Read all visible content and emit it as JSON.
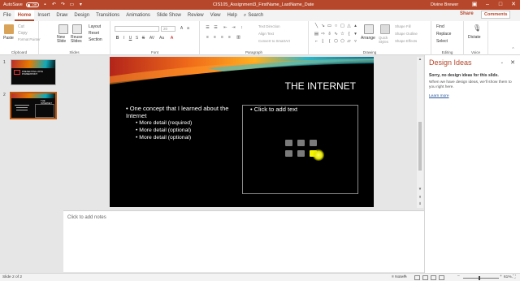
{
  "titlebar": {
    "autosave_label": "AutoSave",
    "autosave_state": "Off",
    "doc_title": "CIS105_Assignment3_FirstName_LastName_Date",
    "user": "Divine Brewer",
    "accent": "#b7472a"
  },
  "tabs": [
    "File",
    "Home",
    "Insert",
    "Draw",
    "Design",
    "Transitions",
    "Animations",
    "Slide Show",
    "Review",
    "View",
    "Help"
  ],
  "active_tab": "Home",
  "search_label": "Search",
  "share_label": "Share",
  "comments_label": "Comments",
  "ribbon": {
    "clipboard": {
      "paste": "Paste",
      "cut": "Cut",
      "copy": "Copy",
      "format_painter": "Format Painter",
      "label": "Clipboard"
    },
    "slides": {
      "new_slide": "New Slide",
      "reuse_slides": "Reuse Slides",
      "layout": "Layout",
      "reset": "Reset",
      "section": "Section",
      "label": "Slides"
    },
    "font": {
      "label": "Font",
      "size": "20",
      "bold": "B",
      "italic": "I",
      "underline": "U",
      "strike": "S",
      "shadow": "S",
      "spacing": "AV",
      "case": "Aa"
    },
    "paragraph": {
      "text_direction": "Text Direction",
      "align_text": "Align Text",
      "convert_smartart": "Convert to SmartArt",
      "label": "Paragraph"
    },
    "drawing": {
      "arrange": "Arrange",
      "quick_styles": "Quick Styles",
      "shape_fill": "Shape Fill",
      "shape_outline": "Shape Outline",
      "shape_effects": "Shape Effects",
      "label": "Drawing"
    },
    "editing": {
      "find": "Find",
      "replace": "Replace",
      "select": "Select",
      "label": "Editing"
    },
    "voice": {
      "dictate": "Dictate",
      "label": "Voice"
    }
  },
  "thumbnails": [
    {
      "number": "1",
      "title": "PRESENTING WITH POWERPOINT"
    },
    {
      "number": "2",
      "title": "THE INTERNET"
    }
  ],
  "slide": {
    "title": "THE INTERNET",
    "bullet_main": "One concept that I learned about the Internet",
    "sub_bullets": [
      "More detail (required)",
      "More detail (optional)",
      "More detail (optional)"
    ],
    "placeholder_text": "Click to add text"
  },
  "notes_placeholder": "Click to add notes",
  "design_ideas": {
    "title": "Design Ideas",
    "sorry": "Sorry, no design ideas for this slide.",
    "message": "When we have design ideas, we'll show them to you right here.",
    "learn_more": "Learn more"
  },
  "status": {
    "slide_counter": "Slide 2 of 2",
    "notes": "Notes",
    "comments": "Comments",
    "zoom": "61%"
  }
}
